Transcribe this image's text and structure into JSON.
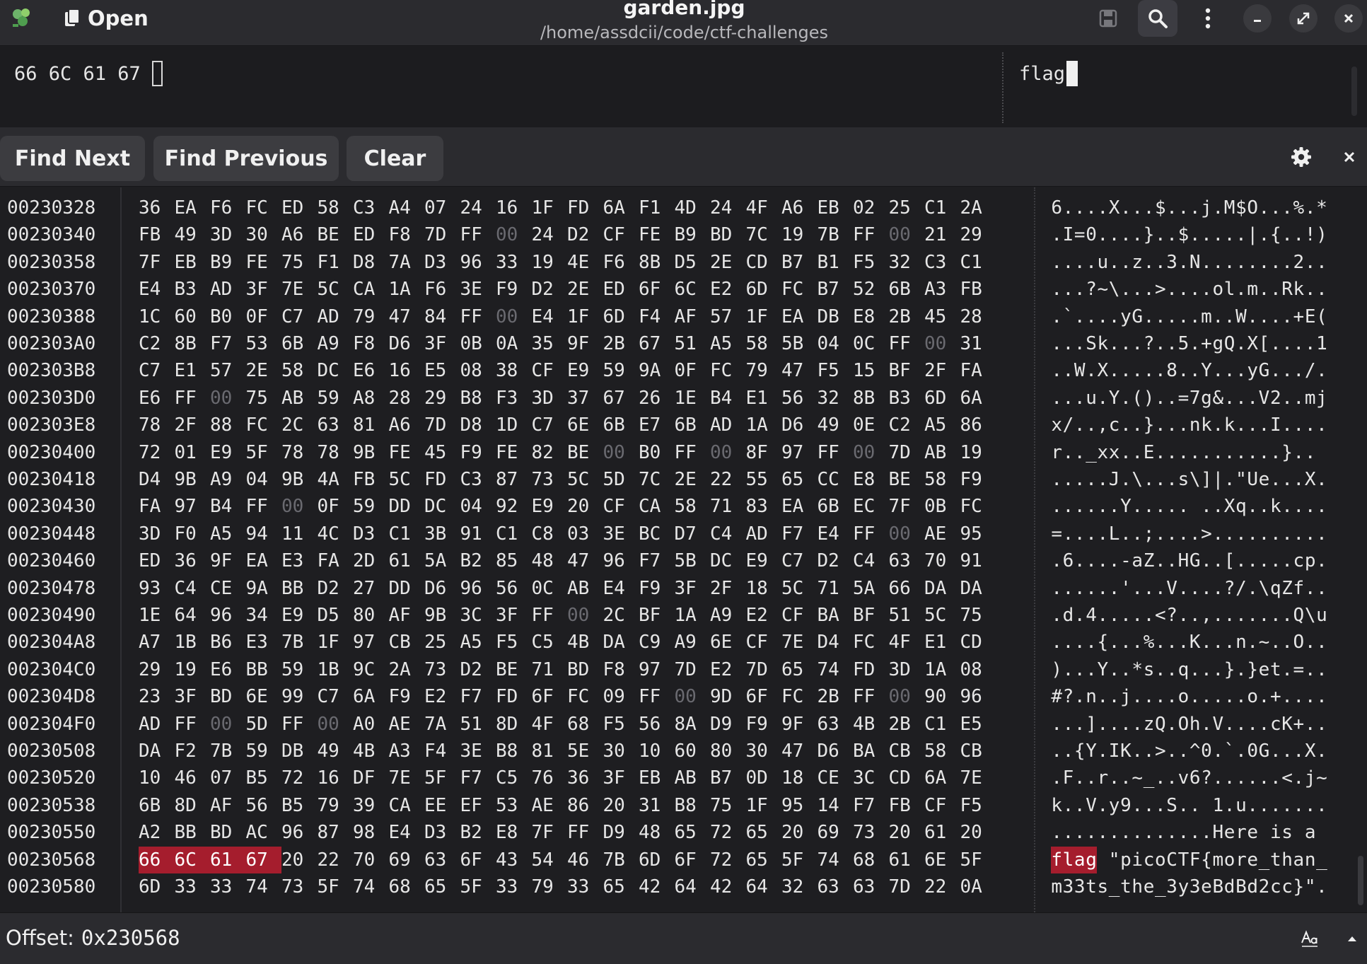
{
  "window": {
    "title": "garden.jpg",
    "subtitle": "/home/assdcii/code/ctf-challenges",
    "open_label": "Open",
    "icons": [
      "app-icon",
      "save-icon",
      "search-icon",
      "menu-icon",
      "minimize-icon",
      "maximize-icon",
      "close-icon"
    ]
  },
  "search": {
    "hex_query": "66 6C 61 67",
    "ascii_query": "flag"
  },
  "findbar": {
    "find_next": "Find Next",
    "find_previous": "Find Previous",
    "clear": "Clear"
  },
  "status": {
    "label": "Offset:",
    "value": "0x230568"
  },
  "colors": {
    "accent": "#a51d2d",
    "background": "#1e1e21",
    "headerbar": "#2b2b2f"
  },
  "selection": {
    "row": 24,
    "start": 0,
    "length": 4
  },
  "rows": [
    {
      "offset": "00230328",
      "hex": "36 EA F6 FC ED 58 C3 A4 07 24 16 1F FD 6A F1 4D 24 4F A6 EB 02 25 C1 2A",
      "ascii": "6....X...$...j.M$O...%.*"
    },
    {
      "offset": "00230340",
      "hex": "FB 49 3D 30 A6 BE ED F8 7D FF 00 24 D2 CF FE B9 BD 7C 19 7B FF 00 21 29",
      "ascii": ".I=0....}..$.....|.{..!)"
    },
    {
      "offset": "00230358",
      "hex": "7F EB B9 FE 75 F1 D8 7A D3 96 33 19 4E F6 8B D5 2E CD B7 B1 F5 32 C3 C1",
      "ascii": "....u..z..3.N........2.."
    },
    {
      "offset": "00230370",
      "hex": "E4 B3 AD 3F 7E 5C CA 1A F6 3E F9 D2 2E ED 6F 6C E2 6D FC B7 52 6B A3 FB",
      "ascii": "...?~\\...>....ol.m..Rk.."
    },
    {
      "offset": "00230388",
      "hex": "1C 60 B0 0F C7 AD 79 47 84 FF 00 E4 1F 6D F4 AF 57 1F EA DB E8 2B 45 28",
      "ascii": ".`....yG.....m..W....+E("
    },
    {
      "offset": "002303A0",
      "hex": "C2 8B F7 53 6B A9 F8 D6 3F 0B 0A 35 9F 2B 67 51 A5 58 5B 04 0C FF 00 31",
      "ascii": "...Sk...?..5.+gQ.X[....1"
    },
    {
      "offset": "002303B8",
      "hex": "C7 E1 57 2E 58 DC E6 16 E5 08 38 CF E9 59 9A 0F FC 79 47 F5 15 BF 2F FA",
      "ascii": "..W.X.....8..Y...yG.../."
    },
    {
      "offset": "002303D0",
      "hex": "E6 FF 00 75 AB 59 A8 28 29 B8 F3 3D 37 67 26 1E B4 E1 56 32 8B B3 6D 6A",
      "ascii": "...u.Y.()..=7g&...V2..mj"
    },
    {
      "offset": "002303E8",
      "hex": "78 2F 88 FC 2C 63 81 A6 7D D8 1D C7 6E 6B E7 6B AD 1A D6 49 0E C2 A5 86",
      "ascii": "x/..,c..}...nk.k...I...."
    },
    {
      "offset": "00230400",
      "hex": "72 01 E9 5F 78 78 9B FE 45 F9 FE 82 BE 00 B0 FF 00 8F 97 FF 00 7D AB 19",
      "ascii": "r.._xx..E...........}.."
    },
    {
      "offset": "00230418",
      "hex": "D4 9B A9 04 9B 4A FB 5C FD C3 87 73 5C 5D 7C 2E 22 55 65 CC E8 BE 58 F9",
      "ascii": ".....J.\\...s\\]|.\"Ue...X."
    },
    {
      "offset": "00230430",
      "hex": "FA 97 B4 FF 00 0F 59 DD DC 04 92 E9 20 CF CA 58 71 83 EA 6B EC 7F 0B FC",
      "ascii": "......Y..... ..Xq..k...."
    },
    {
      "offset": "00230448",
      "hex": "3D F0 A5 94 11 4C D3 C1 3B 91 C1 C8 03 3E BC D7 C4 AD F7 E4 FF 00 AE 95",
      "ascii": "=....L..;....>.........."
    },
    {
      "offset": "00230460",
      "hex": "ED 36 9F EA E3 FA 2D 61 5A B2 85 48 47 96 F7 5B DC E9 C7 D2 C4 63 70 91",
      "ascii": ".6....-aZ..HG..[.....cp."
    },
    {
      "offset": "00230478",
      "hex": "93 C4 CE 9A BB D2 27 DD D6 96 56 0C AB E4 F9 3F 2F 18 5C 71 5A 66 DA DA",
      "ascii": "......'...V....?/.\\qZf.."
    },
    {
      "offset": "00230490",
      "hex": "1E 64 96 34 E9 D5 80 AF 9B 3C 3F FF 00 2C BF 1A A9 E2 CF BA BF 51 5C 75",
      "ascii": ".d.4.....<?..,.......Q\\u"
    },
    {
      "offset": "002304A8",
      "hex": "A7 1B B6 E3 7B 1F 97 CB 25 A5 F5 C5 4B DA C9 A9 6E CF 7E D4 FC 4F E1 CD",
      "ascii": "....{...%...K...n.~..O.."
    },
    {
      "offset": "002304C0",
      "hex": "29 19 E6 BB 59 1B 9C 2A 73 D2 BE 71 BD F8 97 7D E2 7D 65 74 FD 3D 1A 08",
      "ascii": ")...Y..*s..q...}.}et.=.."
    },
    {
      "offset": "002304D8",
      "hex": "23 3F BD 6E 99 C7 6A F9 E2 F7 FD 6F FC 09 FF 00 9D 6F FC 2B FF 00 90 96",
      "ascii": "#?.n..j....o.....o.+...."
    },
    {
      "offset": "002304F0",
      "hex": "AD FF 00 5D FF 00 A0 AE 7A 51 8D 4F 68 F5 56 8A D9 F9 9F 63 4B 2B C1 E5",
      "ascii": "...]....zQ.Oh.V....cK+.."
    },
    {
      "offset": "00230508",
      "hex": "DA F2 7B 59 DB 49 4B A3 F4 3E B8 81 5E 30 10 60 80 30 47 D6 BA CB 58 CB",
      "ascii": "..{Y.IK..>..^0.`.0G...X."
    },
    {
      "offset": "00230520",
      "hex": "10 46 07 B5 72 16 DF 7E 5F F7 C5 76 36 3F EB AB B7 0D 18 CE 3C CD 6A 7E",
      "ascii": ".F..r..~_..v6?......<.j~"
    },
    {
      "offset": "00230538",
      "hex": "6B 8D AF 56 B5 79 39 CA EE EF 53 AE 86 20 31 B8 75 1F 95 14 F7 FB CF F5",
      "ascii": "k..V.y9...S.. 1.u......."
    },
    {
      "offset": "00230550",
      "hex": "A2 BB BD AC 96 87 98 E4 D3 B2 E8 7F FF D9 48 65 72 65 20 69 73 20 61 20",
      "ascii": "..............Here is a "
    },
    {
      "offset": "00230568",
      "hex": "66 6C 61 67 20 22 70 69 63 6F 43 54 46 7B 6D 6F 72 65 5F 74 68 61 6E 5F",
      "ascii": "flag \"picoCTF{more_than_"
    },
    {
      "offset": "00230580",
      "hex": "6D 33 33 74 73 5F 74 68 65 5F 33 79 33 65 42 64 42 64 32 63 63 7D 22 0A",
      "ascii": "m33ts_the_3y3eBdBd2cc}\"."
    }
  ]
}
